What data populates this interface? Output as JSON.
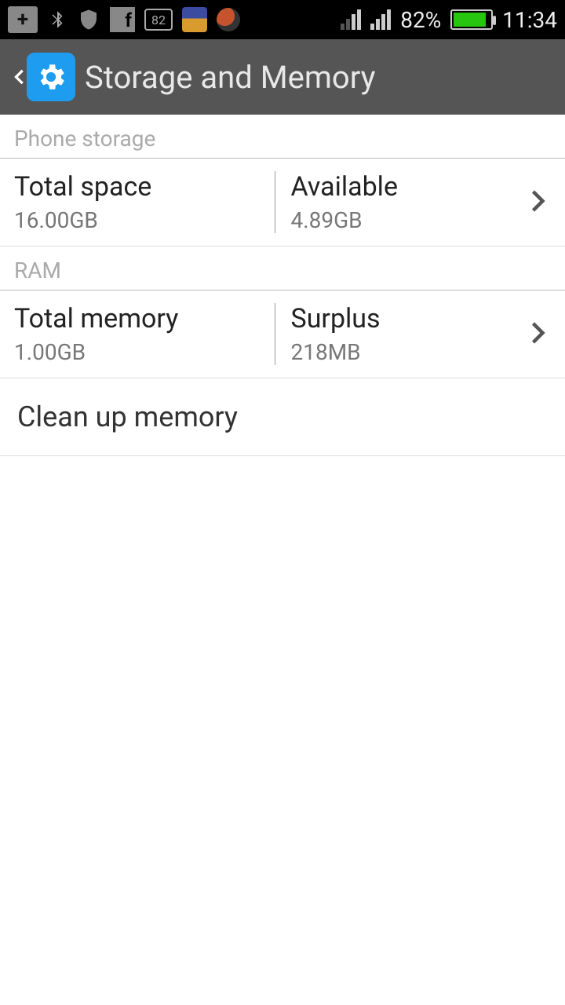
{
  "statusbar": {
    "battery_percent": "82%",
    "time": "11:34",
    "notif_count": "82"
  },
  "appbar": {
    "title": "Storage and Memory"
  },
  "sections": {
    "phone_storage": {
      "header": "Phone storage",
      "total_label": "Total space",
      "total_value": "16.00GB",
      "available_label": "Available",
      "available_value": "4.89GB"
    },
    "ram": {
      "header": "RAM",
      "total_label": "Total memory",
      "total_value": "1.00GB",
      "surplus_label": "Surplus",
      "surplus_value": "218MB"
    }
  },
  "cleanup": {
    "label": "Clean up memory"
  }
}
